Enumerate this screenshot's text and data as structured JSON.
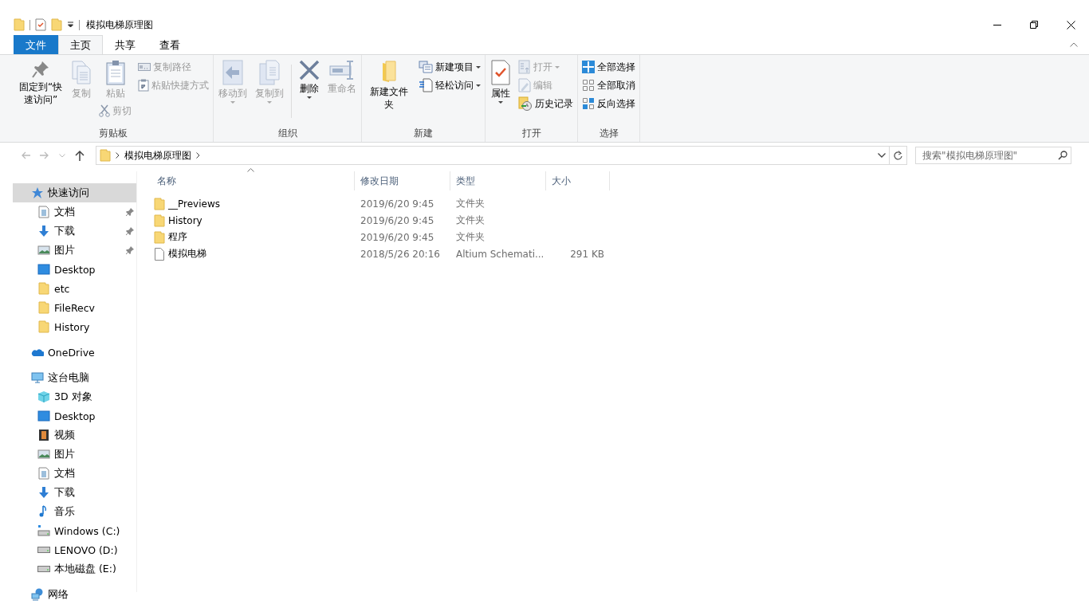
{
  "window": {
    "title": "模拟电梯原理图"
  },
  "ribbon_tabs": [
    {
      "label": "文件",
      "kind": "file",
      "selected": false
    },
    {
      "label": "主页",
      "kind": "tab",
      "selected": true
    },
    {
      "label": "共享",
      "kind": "tab",
      "selected": false
    },
    {
      "label": "查看",
      "kind": "tab",
      "selected": false
    }
  ],
  "ribbon_groups": [
    {
      "label": "剪贴板",
      "columns": [
        [
          {
            "kind": "large",
            "label": "固定到“快速访问”",
            "disabled": false,
            "dropdown": false
          }
        ],
        [
          {
            "kind": "large",
            "label": "复制",
            "disabled": true,
            "dropdown": false
          }
        ],
        [
          {
            "kind": "large",
            "label": "粘贴",
            "disabled": true,
            "dropdown": false
          },
          {
            "kind": "small",
            "label": "剪切",
            "disabled": true,
            "dropdown": false
          }
        ],
        [
          {
            "kind": "small",
            "label": "复制路径",
            "disabled": true,
            "dropdown": false
          },
          {
            "kind": "small",
            "label": "粘贴快捷方式",
            "disabled": true,
            "dropdown": false
          }
        ]
      ]
    },
    {
      "label": "组织",
      "columns": [
        [
          {
            "kind": "large",
            "label": "移动到",
            "disabled": true,
            "dropdown": true
          }
        ],
        [
          {
            "kind": "large",
            "label": "复制到",
            "disabled": true,
            "dropdown": true
          }
        ],
        [
          {
            "kind": "large",
            "label": "删除",
            "disabled": false,
            "dropdown": true
          }
        ],
        [
          {
            "kind": "large",
            "label": "重命名",
            "disabled": true,
            "dropdown": false
          }
        ]
      ]
    },
    {
      "label": "新建",
      "columns": [
        [
          {
            "kind": "large",
            "label": "新建文件夹",
            "disabled": false,
            "dropdown": false
          }
        ],
        [
          {
            "kind": "small",
            "label": "新建项目",
            "disabled": false,
            "dropdown": true
          },
          {
            "kind": "small",
            "label": "轻松访问",
            "disabled": false,
            "dropdown": true
          }
        ]
      ]
    },
    {
      "label": "打开",
      "columns": [
        [
          {
            "kind": "large",
            "label": "属性",
            "disabled": false,
            "dropdown": true
          }
        ],
        [
          {
            "kind": "small",
            "label": "打开",
            "disabled": true,
            "dropdown": true
          },
          {
            "kind": "small",
            "label": "编辑",
            "disabled": true,
            "dropdown": false
          },
          {
            "kind": "small",
            "label": "历史记录",
            "disabled": false,
            "dropdown": false
          }
        ]
      ]
    },
    {
      "label": "选择",
      "columns": [
        [
          {
            "kind": "small",
            "label": "全部选择",
            "disabled": false,
            "dropdown": false
          },
          {
            "kind": "small",
            "label": "全部取消",
            "disabled": false,
            "dropdown": false
          },
          {
            "kind": "small",
            "label": "反向选择",
            "disabled": false,
            "dropdown": false
          }
        ]
      ]
    }
  ],
  "address_bar": {
    "path": [
      "模拟电梯原理图"
    ]
  },
  "search": {
    "placeholder": "搜索\"模拟电梯原理图\""
  },
  "navigation_pane": [
    {
      "label": "快速访问",
      "selected": true,
      "children": [
        {
          "label": "文档",
          "pinned": true,
          "selected": false
        },
        {
          "label": "下载",
          "pinned": true,
          "selected": false
        },
        {
          "label": "图片",
          "pinned": true,
          "selected": false
        },
        {
          "label": "Desktop",
          "pinned": false,
          "selected": false
        },
        {
          "label": "etc",
          "pinned": false,
          "selected": false
        },
        {
          "label": "FileRecv",
          "pinned": false,
          "selected": false
        },
        {
          "label": "History",
          "pinned": false,
          "selected": false
        }
      ]
    },
    {
      "label": "OneDrive",
      "selected": false
    },
    {
      "label": "这台电脑",
      "selected": false,
      "children": [
        {
          "label": "3D 对象",
          "pinned": false,
          "selected": false
        },
        {
          "label": "Desktop",
          "pinned": false,
          "selected": false
        },
        {
          "label": "视频",
          "pinned": false,
          "selected": false
        },
        {
          "label": "图片",
          "pinned": false,
          "selected": false
        },
        {
          "label": "文档",
          "pinned": false,
          "selected": false
        },
        {
          "label": "下载",
          "pinned": false,
          "selected": false
        },
        {
          "label": "音乐",
          "pinned": false,
          "selected": false
        },
        {
          "label": "Windows (C:)",
          "pinned": false,
          "selected": false
        },
        {
          "label": "LENOVO (D:)",
          "pinned": false,
          "selected": false
        },
        {
          "label": "本地磁盘 (E:)",
          "pinned": false,
          "selected": false
        }
      ]
    },
    {
      "label": "网络",
      "selected": false
    }
  ],
  "file_list": {
    "columns": [
      {
        "label": "名称",
        "sorted": true
      },
      {
        "label": "修改日期",
        "sorted": false
      },
      {
        "label": "类型",
        "sorted": false
      },
      {
        "label": "大小",
        "sorted": false
      }
    ],
    "rows": [
      {
        "kind": "folder",
        "name": "__Previews",
        "date": "2019/6/20 9:45",
        "type": "文件夹"
      },
      {
        "kind": "folder",
        "name": "History",
        "date": "2019/6/20 9:45",
        "type": "文件夹"
      },
      {
        "kind": "folder",
        "name": "程序",
        "date": "2019/6/20 9:45",
        "type": "文件夹"
      },
      {
        "kind": "file",
        "name": "模拟电梯",
        "date": "2018/5/26 20:16",
        "type": "Altium Schemati...",
        "size": "291 KB"
      }
    ]
  }
}
